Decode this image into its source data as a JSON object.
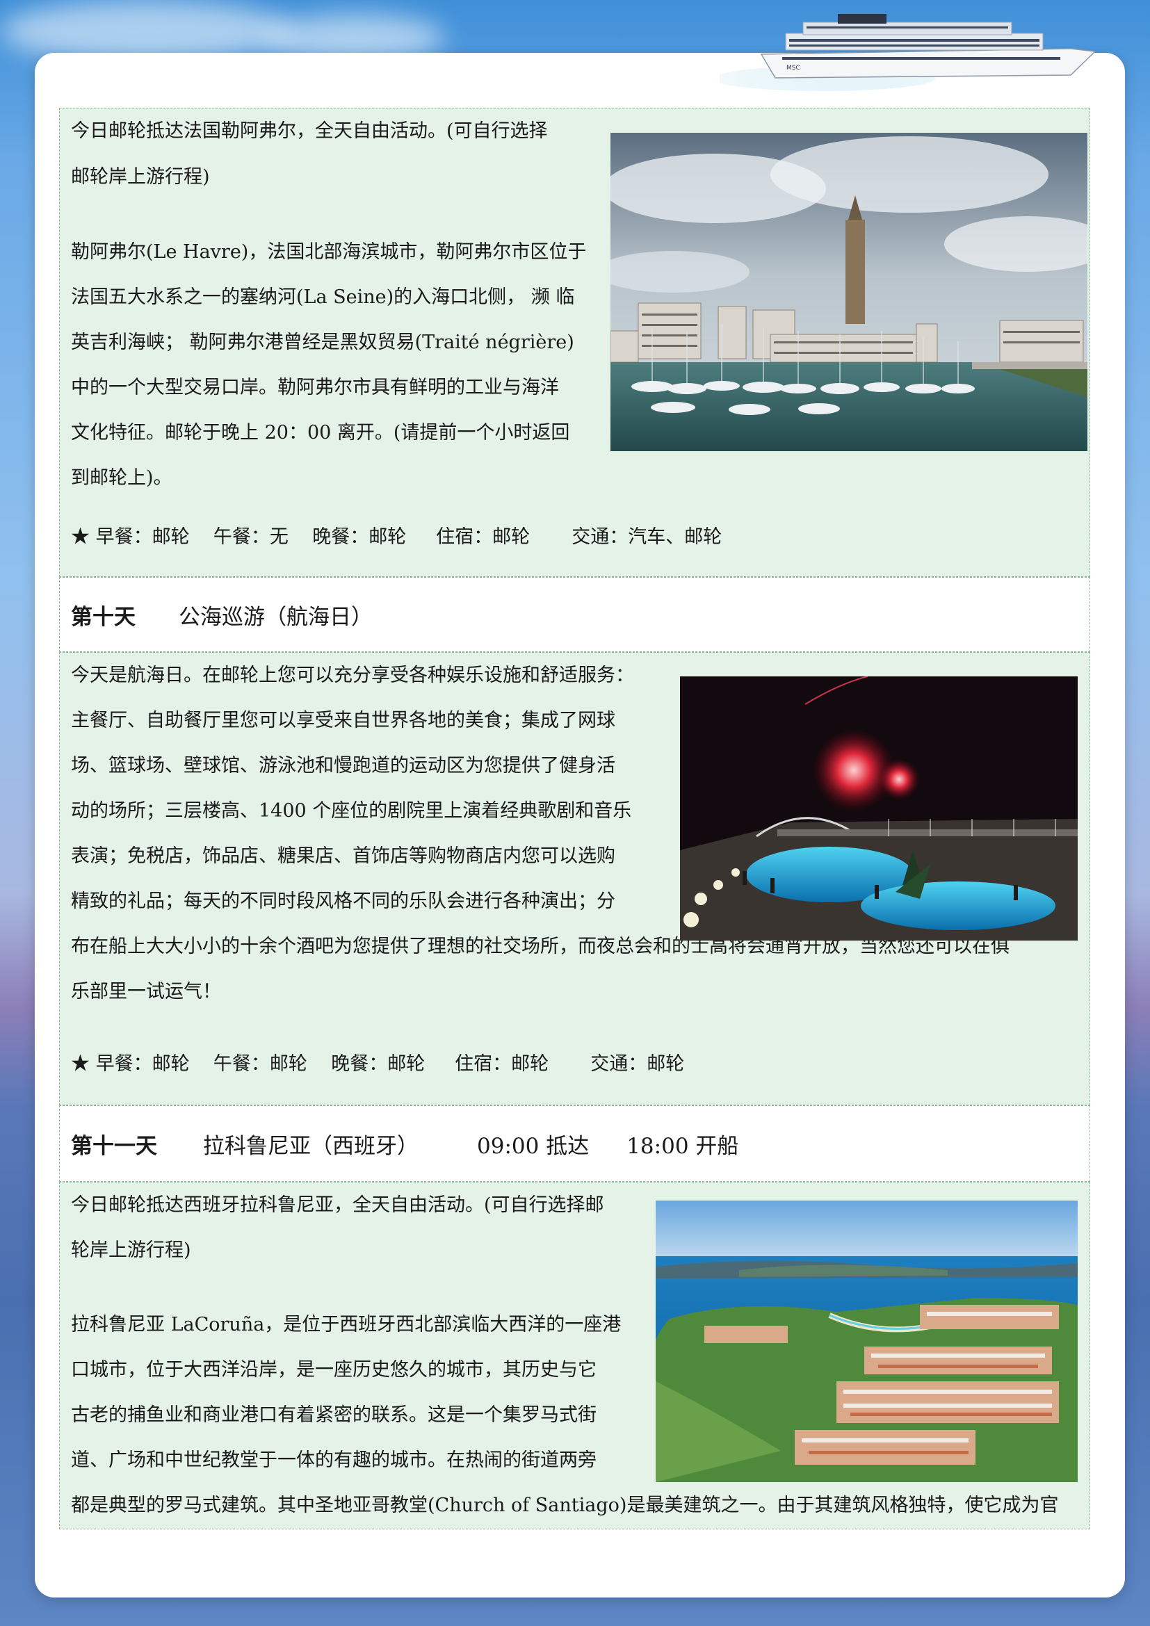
{
  "section1": {
    "intro_line1": "今日邮轮抵达法国勒阿弗尔，全天自由活动。(可自行选择",
    "intro_line2": "邮轮岸上游行程)",
    "body_lines": [
      "勒阿弗尔(Le Havre)，法国北部海滨城市，勒阿弗尔市区位于",
      "法国五大水系之一的塞纳河(La Seine)的入海口北侧， 濒  临",
      "英吉利海峡；  勒阿弗尔港曾经是黑奴贸易(Traité négrière)",
      "中的一个大型交易口岸。勒阿弗尔市具有鲜明的工业与海洋",
      "文化特征。邮轮于晚上 20：00 离开。(请提前一个小时返回",
      "到邮轮上)。"
    ],
    "meals": "★ 早餐：邮轮    午餐：无    晚餐：邮轮     住宿：邮轮       交通：汽车、邮轮"
  },
  "day10": {
    "label": "第十天",
    "title": "公海巡游（航海日）"
  },
  "section2": {
    "lines": [
      "今天是航海日。在邮轮上您可以充分享受各种娱乐设施和舒适服务：",
      "主餐厅、自助餐厅里您可以享受来自世界各地的美食；集成了网球",
      "场、篮球场、壁球馆、游泳池和慢跑道的运动区为您提供了健身活",
      "动的场所；三层楼高、1400 个座位的剧院里上演着经典歌剧和音乐",
      "表演；免税店，饰品店、糖果店、首饰店等购物商店内您可以选购",
      "精致的礼品；每天的不同时段风格不同的乐队会进行各种演出；分",
      "布在船上大大小小的十余个酒吧为您提供了理想的社交场所，而夜总会和的士高将会通宵开放，当然您还可以在俱",
      "乐部里一试运气！"
    ],
    "meals": "★ 早餐：邮轮    午餐：邮轮    晚餐：邮轮     住宿：邮轮       交通：邮轮"
  },
  "day11": {
    "label": "第十一天",
    "title": "拉科鲁尼亚（西班牙）",
    "arrive": "09:00 抵达",
    "depart": "18:00 开船"
  },
  "section3": {
    "intro_line1": "今日邮轮抵达西班牙拉科鲁尼亚，全天自由活动。(可自行选择邮",
    "intro_line2": "轮岸上游行程)",
    "body_lines": [
      "拉科鲁尼亚 LaCoruña，是位于西班牙西北部滨临大西洋的一座港",
      "口城市，位于大西洋沿岸，是一座历史悠久的城市，其历史与它",
      "古老的捕鱼业和商业港口有着紧密的联系。这是一个集罗马式街",
      "道、广场和中世纪教堂于一体的有趣的城市。在热闹的街道两旁",
      "都是典型的罗马式建筑。其中圣地亚哥教堂(Church of Santiago)是最美建筑之一。由于其建筑风格独特，使它成为官"
    ]
  },
  "ship": {
    "brand": "MSC"
  }
}
